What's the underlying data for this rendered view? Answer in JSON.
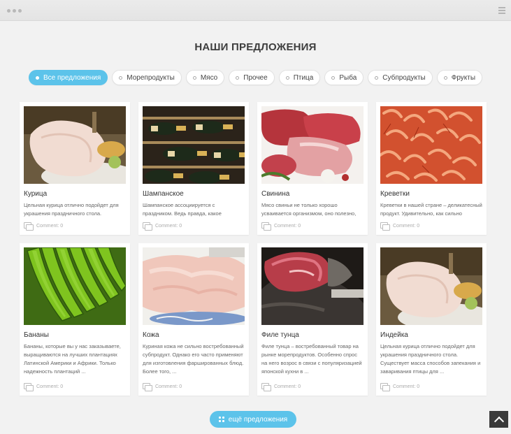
{
  "header": {
    "title": "НАШИ ПРЕДЛОЖЕНИЯ"
  },
  "filters": [
    {
      "label": "Все предложения",
      "active": true
    },
    {
      "label": "Морепродукты",
      "active": false
    },
    {
      "label": "Мясо",
      "active": false
    },
    {
      "label": "Прочее",
      "active": false
    },
    {
      "label": "Птица",
      "active": false
    },
    {
      "label": "Рыба",
      "active": false
    },
    {
      "label": "Субпродукты",
      "active": false
    },
    {
      "label": "Фрукты",
      "active": false
    }
  ],
  "cards": [
    {
      "title": "Курица",
      "description": "Цельная курица отлично подойдет для украшения праздничного стола. Существует",
      "comments": "Comment: 0",
      "image": "raw-chicken-image"
    },
    {
      "title": "Шампанское",
      "description": "Шампанское ассоциируется с праздником. Ведь правда, какое значимое событие",
      "comments": "Comment: 0",
      "image": "champagne-bottles-image"
    },
    {
      "title": "Свинина",
      "description": "Мясо свиньи не только хорошо усваивается организмом, оно полезно, обладает",
      "comments": "Comment: 0",
      "image": "raw-pork-image"
    },
    {
      "title": "Креветки",
      "description": "Креветки в нашей стране – деликатесный продукт. Удивительно, как сильно",
      "comments": "Comment: 0",
      "image": "shrimps-image"
    },
    {
      "title": "Бананы",
      "description": "Бананы, которые вы у нас заказываете, выращиваются на лучших плантациях Латинской Америки и Африки. Только надежность плантаций ...",
      "comments": "Comment: 0",
      "image": "green-bananas-image"
    },
    {
      "title": "Кожа",
      "description": "Куриная кожа не сильно востребованный субпродукт. Однако его часто применяют для изготовления фаршированных блюд. Более того, ...",
      "comments": "Comment: 0",
      "image": "chicken-skin-image"
    },
    {
      "title": "Филе тунца",
      "description": "Филе тунца – востребованный товар на рынке морепродуктов. Особенно спрос на него возрос в связи с популяризацией японской кухни в ...",
      "comments": "Comment: 0",
      "image": "tuna-fillet-image"
    },
    {
      "title": "Индейка",
      "description": "Цельная курица отлично подойдет для украшения праздничного стола. Существует масса способов запекания и заваривания птицы для ...",
      "comments": "Comment: 0",
      "image": "raw-turkey-image"
    }
  ],
  "more_button": {
    "label": "ещё предложения",
    "icon": "grid-icon"
  },
  "scroll_top": {
    "icon": "chevron-up-icon"
  },
  "colors": {
    "accent": "#5cc3ea",
    "background": "#f2f2f2"
  }
}
